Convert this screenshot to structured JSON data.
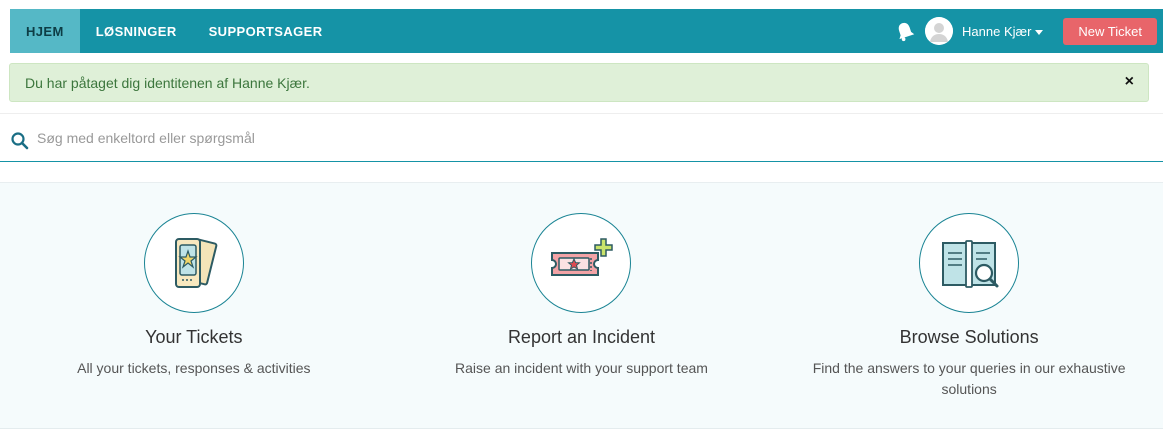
{
  "nav": {
    "items": [
      {
        "label": "HJEM",
        "active": true
      },
      {
        "label": "LØSNINGER",
        "active": false
      },
      {
        "label": "SUPPORTSAGER",
        "active": false
      }
    ],
    "user_name": "Hanne Kjær",
    "new_ticket_label": "New Ticket",
    "bell_icon": "bell-icon",
    "avatar_icon": "avatar"
  },
  "alert": {
    "message": "Du har påtaget dig identitenen af Hanne Kjær.",
    "close": "×"
  },
  "search": {
    "placeholder": "Søg med enkeltord eller spørgsmål",
    "value": ""
  },
  "cards": [
    {
      "title": "Your Tickets",
      "desc": "All your tickets, responses & activities",
      "icon": "tickets-icon"
    },
    {
      "title": "Report an Incident",
      "desc": "Raise an incident with your support team",
      "icon": "report-incident-icon"
    },
    {
      "title": "Browse Solutions",
      "desc": "Find the answers to your queries in our exhaustive solutions",
      "icon": "browse-solutions-icon"
    }
  ],
  "colors": {
    "nav_bg": "#1593a6",
    "nav_active_bg": "#55b8c6",
    "new_ticket_bg": "#e8656a",
    "alert_bg": "#dff0d8",
    "alert_text": "#3c763d",
    "cards_bg": "#f5fbfc"
  }
}
